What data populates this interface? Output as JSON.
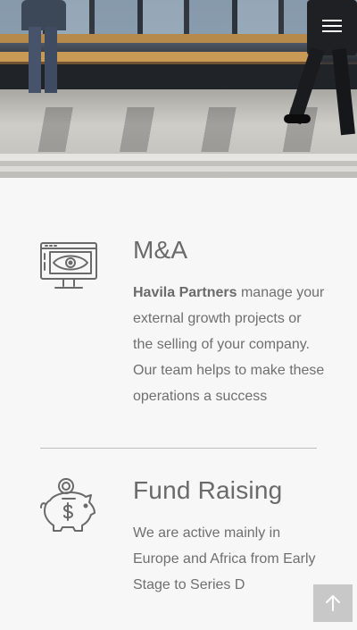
{
  "header": {
    "menu_icon": "hamburger-icon"
  },
  "services": [
    {
      "icon": "monitor-eye-icon",
      "title": "M&A",
      "desc_strong": "Havila Partners",
      "desc_rest": " manage your external growth projects or the selling of your company. Our team helps to make these operations a success"
    },
    {
      "icon": "piggy-bank-icon",
      "title": "Fund Raising",
      "desc": "We are active mainly in Europe and Africa from Early Stage to Series D"
    }
  ],
  "scroll_top": {
    "icon": "arrow-up-icon"
  },
  "colors": {
    "text": "#6f6f6f",
    "background": "#f7f7f7",
    "scroll_button": "#c8c8c8"
  }
}
